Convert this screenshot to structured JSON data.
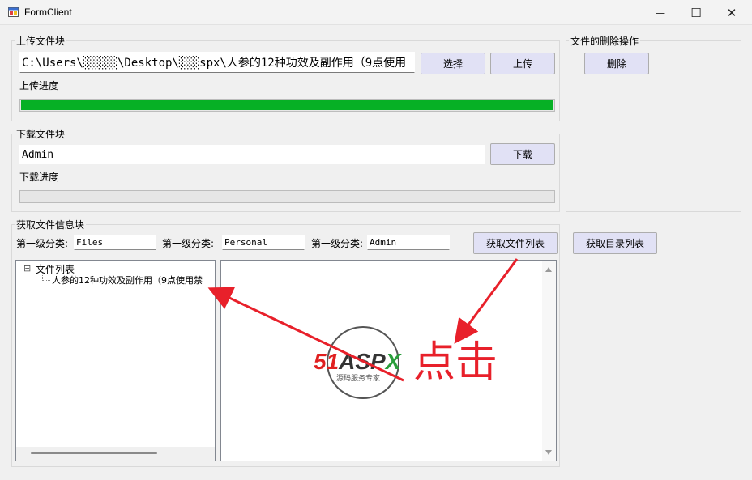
{
  "window": {
    "title": "FormClient",
    "minimize_glyph": "—",
    "maximize_glyph": "☐",
    "close_glyph": "✕"
  },
  "upload": {
    "legend": "上传文件块",
    "path_value": "C:\\Users\\░░░░░\\Desktop\\░░░spx\\人参的12种功效及副作用（9点使用",
    "select_label": "选择",
    "upload_label": "上传",
    "progress_label": "上传进度",
    "progress": 1.0
  },
  "download": {
    "legend": "下载文件块",
    "name_value": "Admin",
    "download_label": "下载",
    "progress_label": "下载进度",
    "progress": 0.0
  },
  "delete": {
    "legend": "文件的删除操作",
    "delete_label": "删除"
  },
  "info": {
    "legend": "获取文件信息块",
    "cat1_label": "第一级分类:",
    "cat1_value": "Files",
    "cat2_label": "第一级分类:",
    "cat2_value": "Personal",
    "cat3_label": "第一级分类:",
    "cat3_value": "Admin",
    "get_file_list_label": "获取文件列表",
    "get_dir_list_label": "获取目录列表"
  },
  "tree": {
    "root_toggle": "⊟",
    "root_label": "文件列表",
    "child_label": "人参的12种功效及副作用（9点使用禁"
  },
  "annotation": {
    "click_text": "点击",
    "logo_text": "51ASPX",
    "logo_sub": "源码服务专家"
  },
  "colors": {
    "progress_green": "#06b025",
    "button_bg": "#e1e1f5",
    "arrow_red": "#e8202a"
  }
}
